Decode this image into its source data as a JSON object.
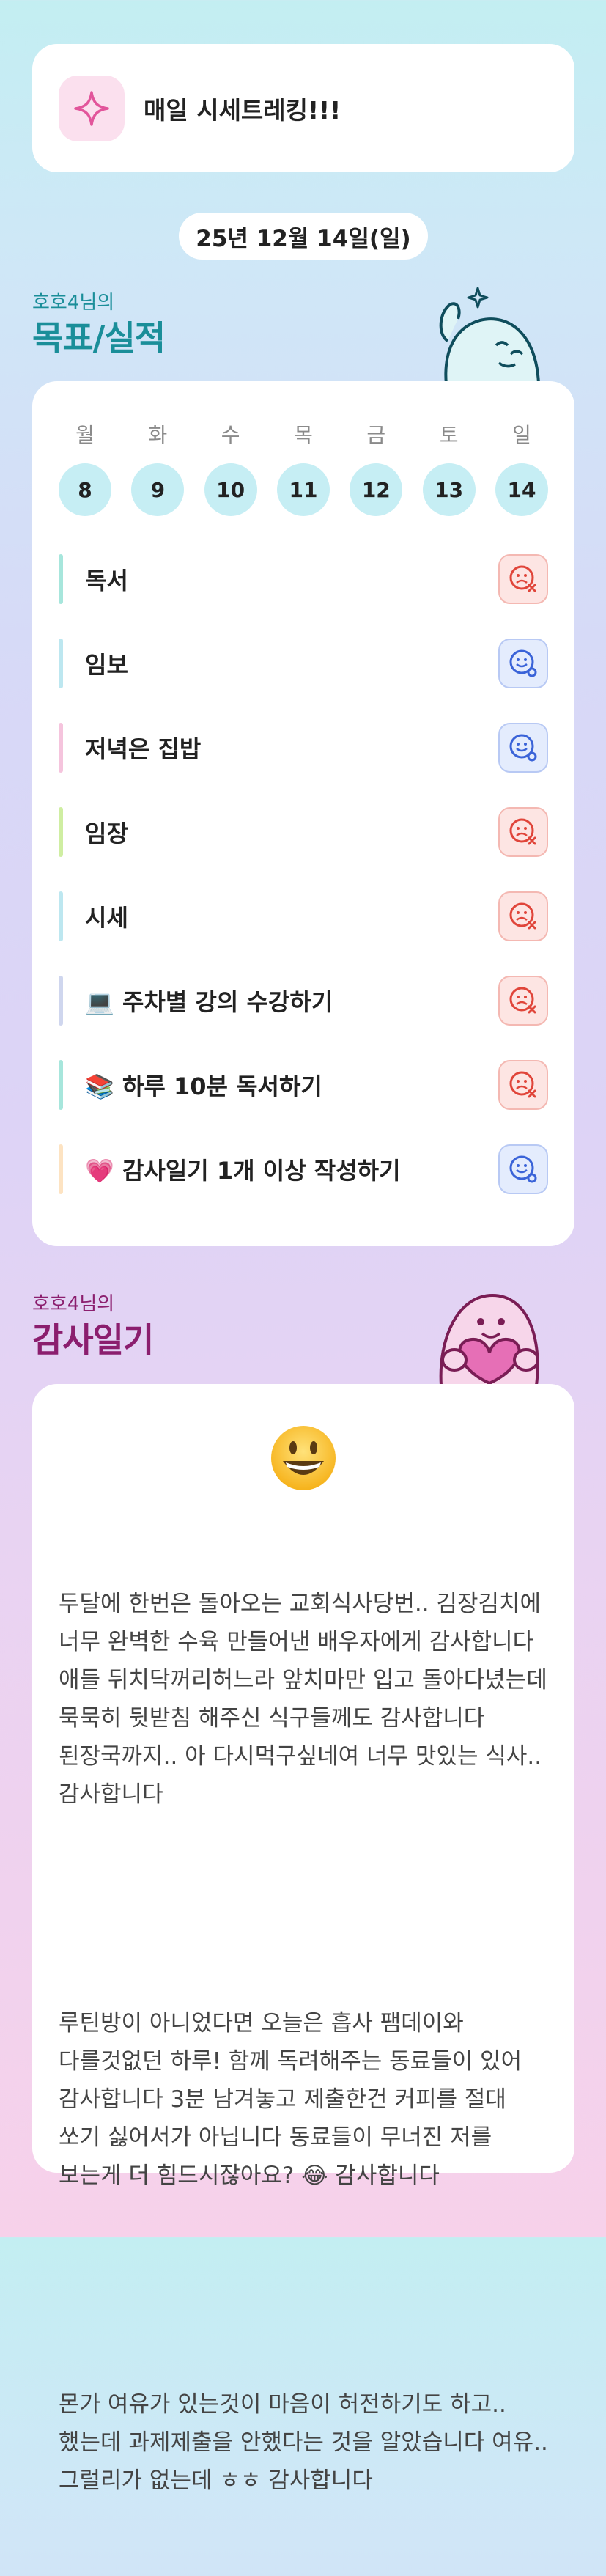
{
  "banner": {
    "title": "매일 시세트레킹!!!",
    "icon": "sparkle-icon"
  },
  "date": "25년 12월 14일(일)",
  "goals_section": {
    "subtitle": "호호4님의",
    "title": "목표/실적"
  },
  "week": {
    "days": [
      "월",
      "화",
      "수",
      "목",
      "금",
      "토",
      "일"
    ],
    "dates": [
      "8",
      "9",
      "10",
      "11",
      "12",
      "13",
      "14"
    ]
  },
  "goals": [
    {
      "label": "독서",
      "status": "fail",
      "color": "#a7e6dc"
    },
    {
      "label": "임보",
      "status": "ok",
      "color": "#bde7f0"
    },
    {
      "label": "저녁은 집밥",
      "status": "ok",
      "color": "#f5c4dd"
    },
    {
      "label": "임장",
      "status": "fail",
      "color": "#cfeea2"
    },
    {
      "label": "시세",
      "status": "fail",
      "color": "#bde7f0"
    },
    {
      "label": "💻 주차별 강의 수강하기",
      "status": "fail",
      "color": "#cfd6ee"
    },
    {
      "label": "📚 하루 10분 독서하기",
      "status": "fail",
      "color": "#a7e6dc"
    },
    {
      "label": "💗 감사일기 1개 이상 작성하기",
      "status": "ok",
      "color": "#fde3c2"
    }
  ],
  "diary_section": {
    "subtitle": "호호4님의",
    "title": "감사일기"
  },
  "diary": {
    "emoji": "grinning-face-icon",
    "paragraphs": [
      "두달에 한번은 돌아오는 교회식사당번.. 김장김치에 너무 완벽한 수육 만들어낸 배우자에게 감사합니다 애들 뒤치닥꺼리허느라 앞치마만 입고 돌아다녔는데 묵묵히 뒷받침 해주신 식구들께도 감사합니다 된장국까지.. 아 다시먹구싶네여 너무 맛있는 식사.. 감사합니다",
      "루틴방이 아니었다면 오늘은 흡사 팸데이와 다를것없던 하루! 함께 독려해주는 동료들이 있어 감사합니다 3분 남겨놓고 제출한건 커피를 절대 쏘기 싫어서가 아닙니다 동료들이 무너진 저를 보는게 더 힘드시잖아요? 😂 감사합니다",
      "몬가 여유가 있는것이 마음이 허전하기도 하고.. 했는데 과제제출을 안했다는 것을 알았습니다 여유..그럴리가 없는데 ㅎㅎ 감사합니다"
    ]
  },
  "colors": {
    "accent_teal": "#1a8e99",
    "accent_purple": "#8b1e6e",
    "fail": "#e0453a",
    "ok": "#3a63d8"
  }
}
